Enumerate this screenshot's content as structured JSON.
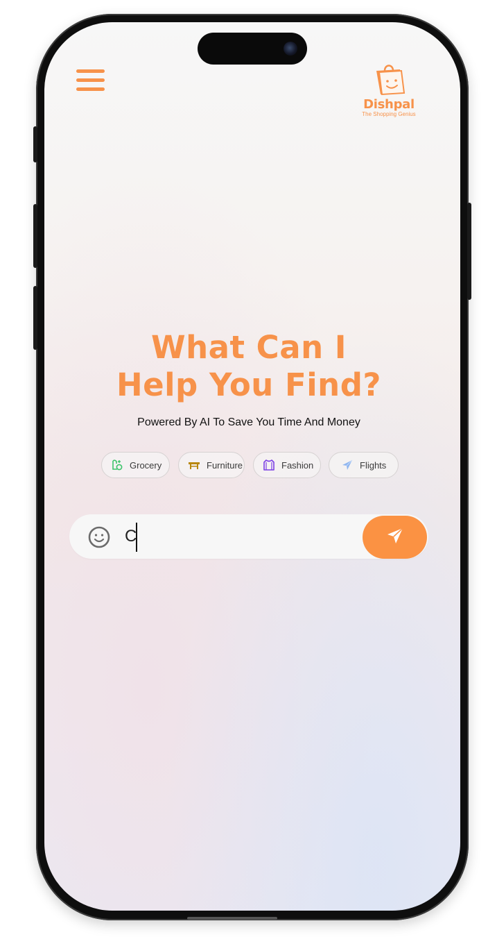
{
  "header": {
    "menu_icon": "hamburger-menu-icon",
    "logo": {
      "name": "Dishpal",
      "tagline": "The Shopping Genius",
      "icon": "shopping-bag-smile-icon"
    }
  },
  "hero": {
    "headline_line1": "What Can I",
    "headline_line2": "Help You Find?",
    "subtitle": "Powered By AI To Save You Time And Money"
  },
  "categories": [
    {
      "label": "Grocery",
      "icon": "grocery-bag-icon",
      "color": "#3cc46a"
    },
    {
      "label": "Furniture",
      "icon": "table-icon",
      "color": "#b8860b"
    },
    {
      "label": "Fashion",
      "icon": "shirt-icon",
      "color": "#7b3fe4"
    },
    {
      "label": "Flights",
      "icon": "airplane-icon",
      "color": "#8fb6f0"
    }
  ],
  "search": {
    "value": "C",
    "emoji_icon": "smiley-icon",
    "send_icon": "send-icon"
  },
  "colors": {
    "accent": "#f7924a",
    "send_button": "#fb9243"
  }
}
